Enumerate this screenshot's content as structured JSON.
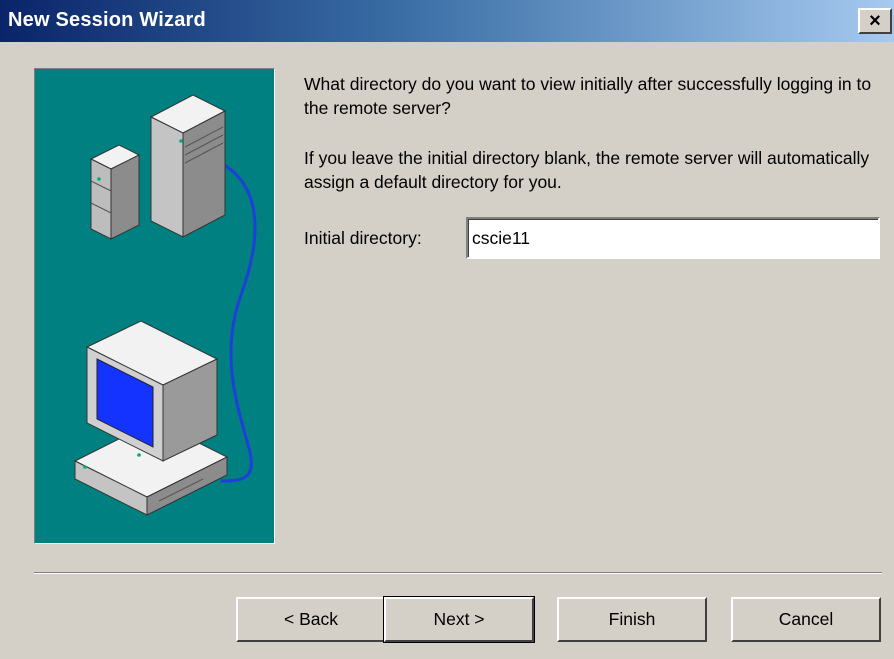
{
  "window": {
    "title": "New Session Wizard",
    "close_symbol": "×"
  },
  "content": {
    "prompt1": "What directory do you want to view initially after successfully logging in to the remote server?",
    "prompt2": "If you leave the initial directory blank, the remote server will automatically assign a default directory for you.",
    "initial_dir_label": "Initial directory:",
    "initial_dir_value": "cscie11"
  },
  "buttons": {
    "back": "< Back",
    "next": "Next >",
    "finish": "Finish",
    "cancel": "Cancel"
  },
  "icons": {
    "illustration": "server-to-computer-illustration",
    "close": "close-icon"
  },
  "colors": {
    "title_gradient_start": "#0a246a",
    "title_gradient_end": "#a6caf0",
    "art_background": "#008080",
    "dialog_face": "#d4d0c8",
    "cable": "#1e40d8",
    "monitor_screen": "#1433ff"
  }
}
